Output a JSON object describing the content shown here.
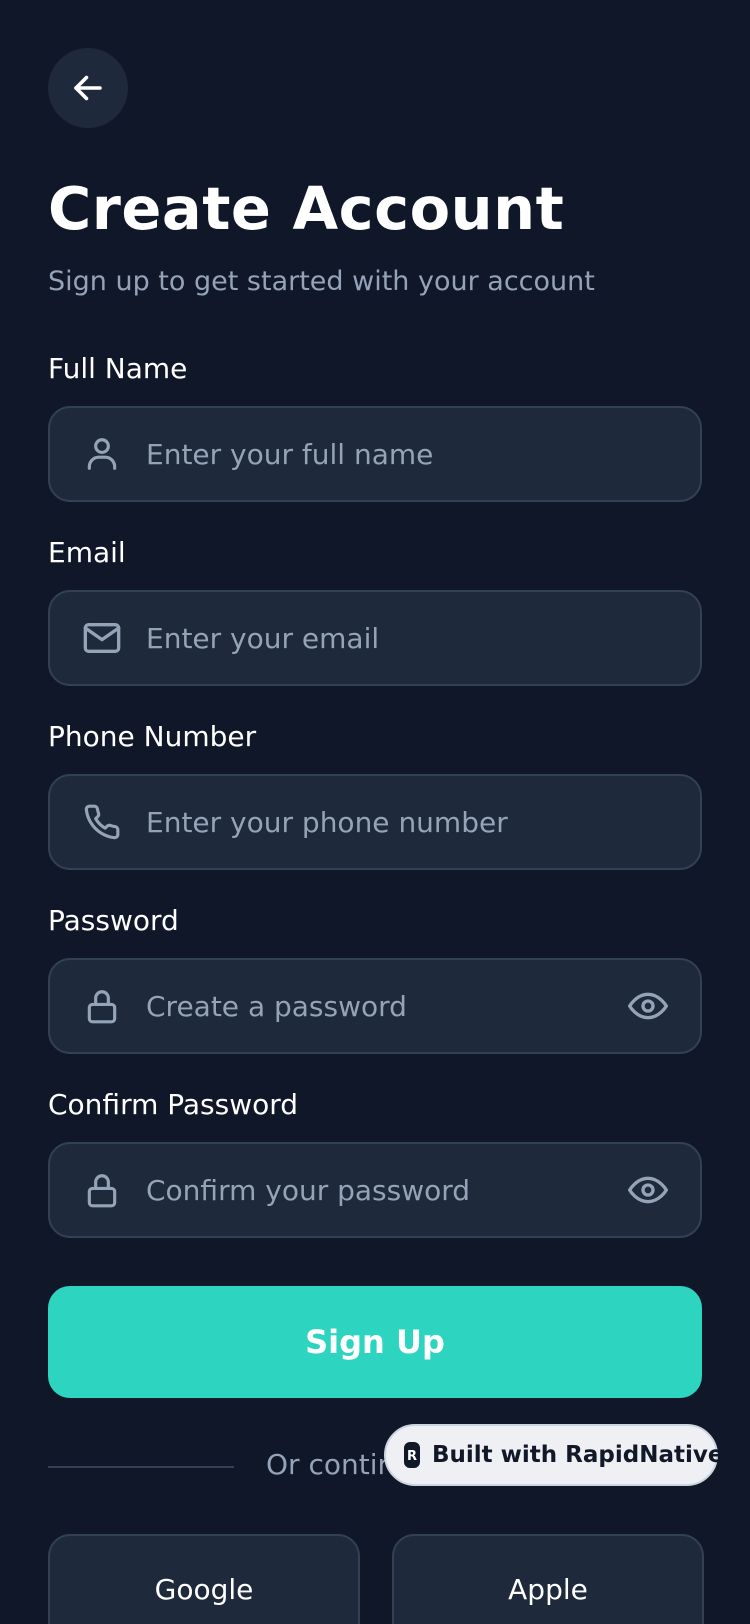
{
  "header": {
    "back_icon": "arrow-left-icon",
    "title": "Create Account",
    "subtitle": "Sign up to get started with your account"
  },
  "form": {
    "full_name": {
      "label": "Full Name",
      "placeholder": "Enter your full name",
      "value": "",
      "icon": "user-icon"
    },
    "email": {
      "label": "Email",
      "placeholder": "Enter your email",
      "value": "",
      "icon": "mail-icon"
    },
    "phone": {
      "label": "Phone Number",
      "placeholder": "Enter your phone number",
      "value": "",
      "icon": "phone-icon"
    },
    "password": {
      "label": "Password",
      "placeholder": "Create a password",
      "value": "",
      "icon": "lock-icon",
      "toggle_icon": "eye-icon"
    },
    "confirm_password": {
      "label": "Confirm Password",
      "placeholder": "Confirm your password",
      "value": "",
      "icon": "lock-icon",
      "toggle_icon": "eye-icon"
    }
  },
  "actions": {
    "signup_label": "Sign Up",
    "divider_text": "Or contin",
    "social": [
      {
        "label": "Google"
      },
      {
        "label": "Apple"
      }
    ]
  },
  "badge": {
    "text": "Built with RapidNative",
    "logo_letter": "R"
  },
  "colors": {
    "background": "#0f1729",
    "surface": "#1e293b",
    "border": "#334155",
    "muted": "#94a3b8",
    "accent": "#2dd4bf"
  }
}
